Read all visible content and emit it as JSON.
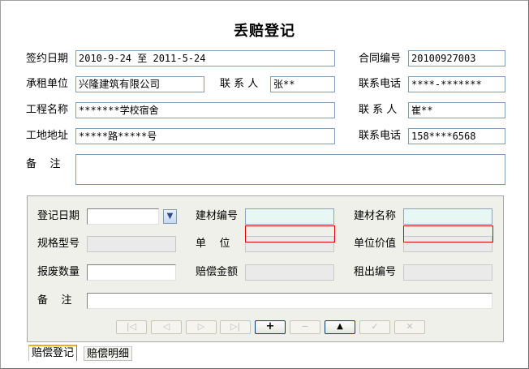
{
  "form_title": "丢赔登记",
  "header": {
    "sign_date_label": "签约日期",
    "sign_date_value": "2010-9-24  至  2011-5-24",
    "contract_no_label": "合同编号",
    "contract_no_value": "20100927003",
    "lessee_label": "承租单位",
    "lessee_value": "兴隆建筑有限公司",
    "contact1_label": "联 系 人",
    "contact1_value": "张**",
    "phone1_label": "联系电话",
    "phone1_value": "****-*******",
    "project_label": "工程名称",
    "project_value": "*******学校宿舍",
    "contact2_label": "联 系 人",
    "contact2_value": "崔**",
    "site_label": "工地地址",
    "site_value": "*****路*****号",
    "phone2_label": "联系电话",
    "phone2_value": "158****6568",
    "remark_label": "备    注",
    "remark_value": ""
  },
  "detail": {
    "reg_date_label": "登记日期",
    "reg_date_value": "",
    "material_no_label": "建材编号",
    "material_no_value": "",
    "material_name_label": "建材名称",
    "material_name_value": "",
    "spec_label": "规格型号",
    "spec_value": "",
    "unit_label": "单    位",
    "unit_value": "",
    "unit_price_label": "单位价值",
    "unit_price_value": "",
    "scrap_qty_label": "报废数量",
    "scrap_qty_value": "",
    "compensation_label": "赔偿金额",
    "compensation_value": "",
    "rental_no_label": "租出编号",
    "rental_no_value": "",
    "remark_label": "备    注",
    "remark_value": ""
  },
  "navigator": {
    "first": "|◁",
    "prior": "◁",
    "next": "▷",
    "last": "▷|",
    "insert": "+",
    "delete": "−",
    "edit": "▲",
    "post": "✓",
    "cancel": "✕"
  },
  "tabs": {
    "registration": "赔偿登记",
    "details": "赔偿明细"
  }
}
